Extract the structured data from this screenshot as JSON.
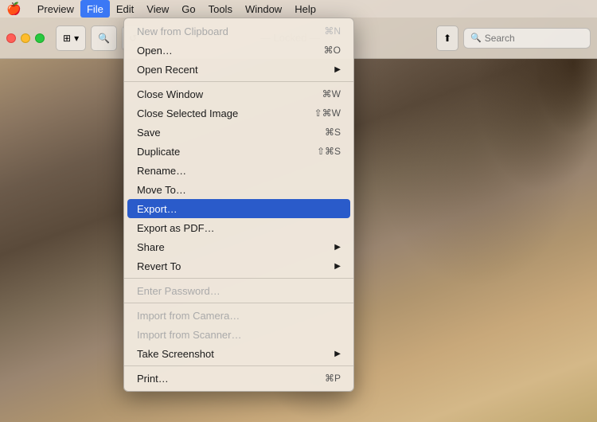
{
  "menubar": {
    "apple": "🍎",
    "items": [
      {
        "label": "Preview",
        "active": false
      },
      {
        "label": "File",
        "active": true
      },
      {
        "label": "Edit",
        "active": false
      },
      {
        "label": "View",
        "active": false
      },
      {
        "label": "Go",
        "active": false
      },
      {
        "label": "Tools",
        "active": false
      },
      {
        "label": "Window",
        "active": false
      },
      {
        "label": "Help",
        "active": false
      }
    ]
  },
  "toolbar": {
    "title": "— Locked —",
    "search_placeholder": "Search"
  },
  "menu": {
    "items": [
      {
        "label": "New from Clipboard",
        "shortcut": "⌘N",
        "disabled": true,
        "separator_after": false
      },
      {
        "label": "Open…",
        "shortcut": "⌘O",
        "disabled": false,
        "separator_after": false
      },
      {
        "label": "Open Recent",
        "shortcut": "▶",
        "disabled": false,
        "separator_after": true
      },
      {
        "label": "Close Window",
        "shortcut": "⌘W",
        "disabled": false,
        "separator_after": false
      },
      {
        "label": "Close Selected Image",
        "shortcut": "⇧⌘W",
        "disabled": false,
        "separator_after": false
      },
      {
        "label": "Save",
        "shortcut": "⌘S",
        "disabled": false,
        "separator_after": false
      },
      {
        "label": "Duplicate",
        "shortcut": "⇧⌘S",
        "disabled": false,
        "separator_after": false
      },
      {
        "label": "Rename…",
        "shortcut": "",
        "disabled": false,
        "separator_after": false
      },
      {
        "label": "Move To…",
        "shortcut": "",
        "disabled": false,
        "separator_after": false
      },
      {
        "label": "Export…",
        "shortcut": "",
        "disabled": false,
        "highlighted": true,
        "separator_after": false
      },
      {
        "label": "Export as PDF…",
        "shortcut": "",
        "disabled": false,
        "separator_after": false
      },
      {
        "label": "Share",
        "shortcut": "▶",
        "disabled": false,
        "separator_after": false
      },
      {
        "label": "Revert To",
        "shortcut": "▶",
        "disabled": false,
        "separator_after": true
      },
      {
        "label": "Enter Password…",
        "shortcut": "",
        "disabled": true,
        "separator_after": false
      },
      {
        "label": "",
        "separator": true
      },
      {
        "label": "Import from Camera…",
        "shortcut": "",
        "disabled": true,
        "separator_after": false
      },
      {
        "label": "Import from Scanner…",
        "shortcut": "",
        "disabled": true,
        "separator_after": false
      },
      {
        "label": "Take Screenshot",
        "shortcut": "▶",
        "disabled": false,
        "separator_after": true
      },
      {
        "label": "Print…",
        "shortcut": "⌘P",
        "disabled": false,
        "separator_after": false
      }
    ]
  }
}
